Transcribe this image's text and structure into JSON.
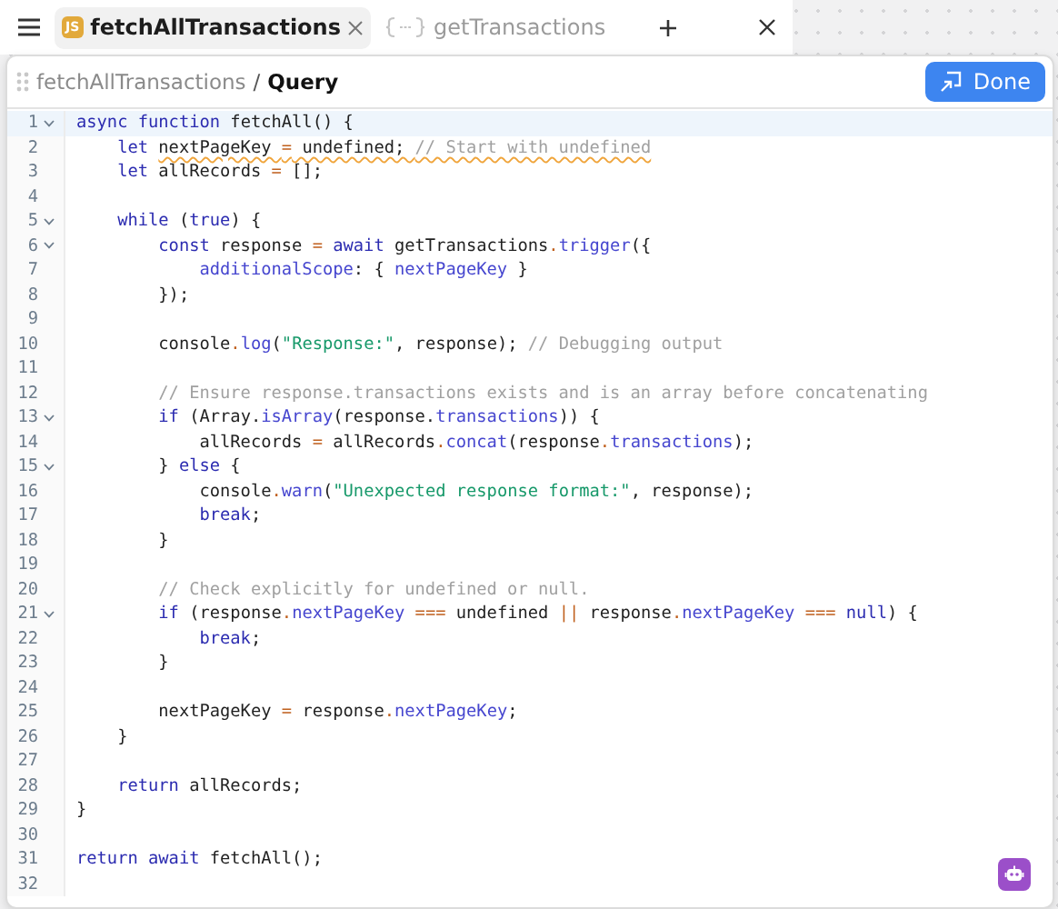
{
  "tabs": [
    {
      "badge": "JS",
      "label": "fetchAllTransactions",
      "kind": "js",
      "selected": true
    },
    {
      "label": "getTransactions",
      "kind": "query",
      "selected": false
    }
  ],
  "panel": {
    "breadcrumb": "fetchAllTransactions",
    "separator": "/",
    "current": "Query",
    "done_button": "Done"
  },
  "editor": {
    "lines": [
      {
        "number": "1",
        "foldable": true,
        "active": true,
        "tokens": [
          {
            "kind": "kw",
            "text": "async function"
          },
          {
            "kind": "plain",
            "text": " fetchAll() {"
          }
        ]
      },
      {
        "number": "2",
        "foldable": false,
        "active": false,
        "tokens": [
          {
            "kind": "kw",
            "text": "    let ",
            "underline": false
          },
          {
            "kind": "plain",
            "text": "nextPageKey ",
            "underline": true
          },
          {
            "kind": "op",
            "text": "=",
            "underline": true
          },
          {
            "kind": "plain",
            "text": " undefined; ",
            "underline": true
          },
          {
            "kind": "cmt",
            "text": "// Start with undefined",
            "underline": true
          }
        ]
      },
      {
        "number": "3",
        "foldable": false,
        "active": false,
        "tokens": [
          {
            "kind": "kw",
            "text": "    let"
          },
          {
            "kind": "plain",
            "text": " allRecords "
          },
          {
            "kind": "op",
            "text": "="
          },
          {
            "kind": "plain",
            "text": " [];"
          }
        ]
      },
      {
        "number": "4",
        "foldable": false,
        "active": false
      },
      {
        "number": "5",
        "foldable": true,
        "active": false,
        "tokens": [
          {
            "kind": "kw",
            "text": "    while"
          },
          {
            "kind": "plain",
            "text": " ("
          },
          {
            "kind": "kw",
            "text": "true"
          },
          {
            "kind": "plain",
            "text": ") {"
          }
        ]
      },
      {
        "number": "6",
        "foldable": true,
        "active": false,
        "tokens": [
          {
            "kind": "kw",
            "text": "        const"
          },
          {
            "kind": "plain",
            "text": " response "
          },
          {
            "kind": "op",
            "text": "="
          },
          {
            "kind": "kw",
            "text": " await"
          },
          {
            "kind": "plain",
            "text": " getTransactions"
          },
          {
            "kind": "op",
            "text": "."
          },
          {
            "kind": "prop",
            "text": "trigger"
          },
          {
            "kind": "plain",
            "text": "({"
          }
        ]
      },
      {
        "number": "7",
        "foldable": false,
        "active": false,
        "tokens": [
          {
            "kind": "prop",
            "text": "            additionalScope"
          },
          {
            "kind": "plain",
            "text": ": { "
          },
          {
            "kind": "prop",
            "text": "nextPageKey"
          },
          {
            "kind": "plain",
            "text": " }"
          }
        ]
      },
      {
        "number": "8",
        "foldable": false,
        "active": false,
        "tokens": [
          {
            "kind": "plain",
            "text": "        });"
          }
        ]
      },
      {
        "number": "9",
        "foldable": false,
        "active": false
      },
      {
        "number": "10",
        "foldable": false,
        "active": false,
        "tokens": [
          {
            "kind": "plain",
            "text": "        console"
          },
          {
            "kind": "op",
            "text": "."
          },
          {
            "kind": "prop",
            "text": "log"
          },
          {
            "kind": "plain",
            "text": "("
          },
          {
            "kind": "str",
            "text": "\"Response:\""
          },
          {
            "kind": "plain",
            "text": ", response); "
          },
          {
            "kind": "cmt",
            "text": "// Debugging output"
          }
        ]
      },
      {
        "number": "11",
        "foldable": false,
        "active": false
      },
      {
        "number": "12",
        "foldable": false,
        "active": false,
        "tokens": [
          {
            "kind": "cmt",
            "text": "        // Ensure response.transactions exists and is an array before concatenating"
          }
        ]
      },
      {
        "number": "13",
        "foldable": true,
        "active": false,
        "tokens": [
          {
            "kind": "kw",
            "text": "        if"
          },
          {
            "kind": "plain",
            "text": " (Array."
          },
          {
            "kind": "prop",
            "text": "isArray"
          },
          {
            "kind": "plain",
            "text": "(response."
          },
          {
            "kind": "prop",
            "text": "transactions"
          },
          {
            "kind": "plain",
            "text": ")) {"
          }
        ]
      },
      {
        "number": "14",
        "foldable": false,
        "active": false,
        "tokens": [
          {
            "kind": "plain",
            "text": "            allRecords "
          },
          {
            "kind": "op",
            "text": "="
          },
          {
            "kind": "plain",
            "text": " allRecords"
          },
          {
            "kind": "op",
            "text": "."
          },
          {
            "kind": "prop",
            "text": "concat"
          },
          {
            "kind": "plain",
            "text": "(response"
          },
          {
            "kind": "op",
            "text": "."
          },
          {
            "kind": "prop",
            "text": "transactions"
          },
          {
            "kind": "plain",
            "text": ");"
          }
        ]
      },
      {
        "number": "15",
        "foldable": true,
        "active": false,
        "tokens": [
          {
            "kind": "plain",
            "text": "        } "
          },
          {
            "kind": "kw",
            "text": "else"
          },
          {
            "kind": "plain",
            "text": " {"
          }
        ]
      },
      {
        "number": "16",
        "foldable": false,
        "active": false,
        "tokens": [
          {
            "kind": "plain",
            "text": "            console"
          },
          {
            "kind": "op",
            "text": "."
          },
          {
            "kind": "prop",
            "text": "warn"
          },
          {
            "kind": "plain",
            "text": "("
          },
          {
            "kind": "str",
            "text": "\"Unexpected response format:\""
          },
          {
            "kind": "plain",
            "text": ", response);"
          }
        ]
      },
      {
        "number": "17",
        "foldable": false,
        "active": false,
        "tokens": [
          {
            "kind": "kw",
            "text": "            break"
          },
          {
            "kind": "plain",
            "text": ";"
          }
        ]
      },
      {
        "number": "18",
        "foldable": false,
        "active": false,
        "tokens": [
          {
            "kind": "plain",
            "text": "        }"
          }
        ]
      },
      {
        "number": "19",
        "foldable": false,
        "active": false
      },
      {
        "number": "20",
        "foldable": false,
        "active": false,
        "tokens": [
          {
            "kind": "cmt",
            "text": "        // Check explicitly for undefined or null."
          }
        ]
      },
      {
        "number": "21",
        "foldable": true,
        "active": false,
        "tokens": [
          {
            "kind": "kw",
            "text": "        if"
          },
          {
            "kind": "plain",
            "text": " (response"
          },
          {
            "kind": "op",
            "text": "."
          },
          {
            "kind": "prop",
            "text": "nextPageKey"
          },
          {
            "kind": "op",
            "text": " ==="
          },
          {
            "kind": "plain",
            "text": " undefined "
          },
          {
            "kind": "op",
            "text": "||"
          },
          {
            "kind": "plain",
            "text": " response"
          },
          {
            "kind": "op",
            "text": "."
          },
          {
            "kind": "prop",
            "text": "nextPageKey"
          },
          {
            "kind": "op",
            "text": " ==="
          },
          {
            "kind": "kw",
            "text": " null"
          },
          {
            "kind": "plain",
            "text": ") {"
          }
        ]
      },
      {
        "number": "22",
        "foldable": false,
        "active": false,
        "tokens": [
          {
            "kind": "kw",
            "text": "            break"
          },
          {
            "kind": "plain",
            "text": ";"
          }
        ]
      },
      {
        "number": "23",
        "foldable": false,
        "active": false,
        "tokens": [
          {
            "kind": "plain",
            "text": "        }"
          }
        ]
      },
      {
        "number": "24",
        "foldable": false,
        "active": false
      },
      {
        "number": "25",
        "foldable": false,
        "active": false,
        "tokens": [
          {
            "kind": "plain",
            "text": "        nextPageKey "
          },
          {
            "kind": "op",
            "text": "="
          },
          {
            "kind": "plain",
            "text": " response"
          },
          {
            "kind": "op",
            "text": "."
          },
          {
            "kind": "prop",
            "text": "nextPageKey"
          },
          {
            "kind": "plain",
            "text": ";"
          }
        ]
      },
      {
        "number": "26",
        "foldable": false,
        "active": false,
        "tokens": [
          {
            "kind": "plain",
            "text": "    }"
          }
        ]
      },
      {
        "number": "27",
        "foldable": false,
        "active": false
      },
      {
        "number": "28",
        "foldable": false,
        "active": false,
        "tokens": [
          {
            "kind": "kw",
            "text": "    return"
          },
          {
            "kind": "plain",
            "text": " allRecords;"
          }
        ]
      },
      {
        "number": "29",
        "foldable": false,
        "active": false,
        "tokens": [
          {
            "kind": "plain",
            "text": "}"
          }
        ]
      },
      {
        "number": "30",
        "foldable": false,
        "active": false
      },
      {
        "number": "31",
        "foldable": false,
        "active": false,
        "tokens": [
          {
            "kind": "kw",
            "text": "return await"
          },
          {
            "kind": "plain",
            "text": " fetchAll();"
          }
        ]
      },
      {
        "number": "32",
        "foldable": false,
        "active": false
      }
    ]
  }
}
